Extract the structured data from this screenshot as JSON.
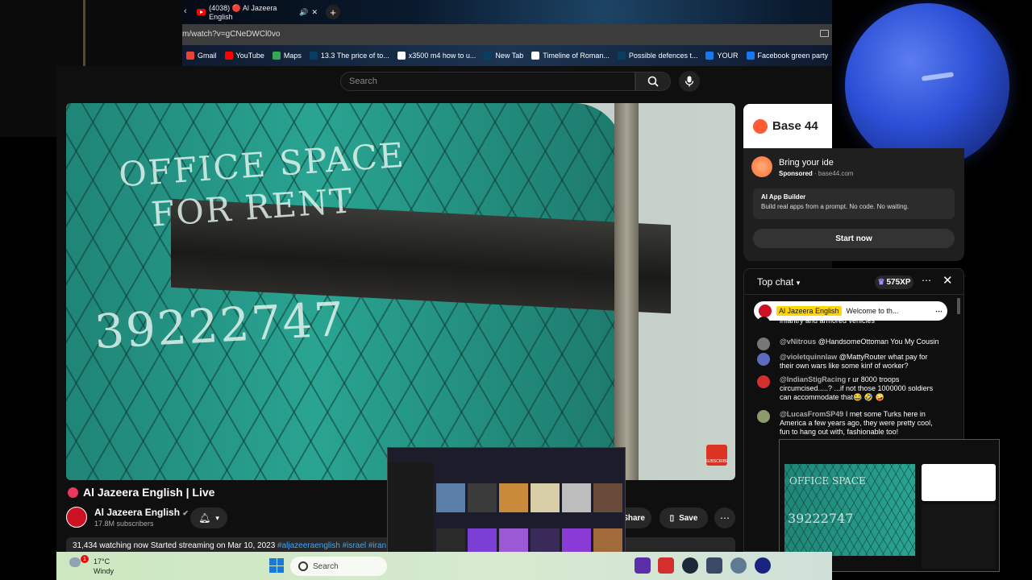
{
  "browser": {
    "tab_title": "(4038) 🔴 Al Jazeera English",
    "url": "m/watch?v=gCNeDWCl0vo",
    "bookmarks": [
      {
        "label": "Gmail",
        "color": "#ea4335"
      },
      {
        "label": "YouTube",
        "color": "#ff0000"
      },
      {
        "label": "Maps",
        "color": "#34a853"
      },
      {
        "label": "13.3 The price of to...",
        "color": "#0a3d62"
      },
      {
        "label": "x3500 m4 how to u...",
        "color": "#ffffff"
      },
      {
        "label": "New Tab",
        "color": "#0a3d62"
      },
      {
        "label": "Timeline of Roman...",
        "color": "#ffffff"
      },
      {
        "label": "Possible defences t...",
        "color": "#0a3d62"
      },
      {
        "label": "YOUR",
        "color": "#1877f2"
      },
      {
        "label": "Facebook green party",
        "color": "#1877f2"
      }
    ]
  },
  "youtube": {
    "search_placeholder": "Search",
    "video": {
      "overlay_line1": "OFFICE SPACE",
      "overlay_line2": "FOR RENT",
      "overlay_number": "39222747",
      "subscribe_badge": "SUBSCRIBE"
    },
    "title": "Al Jazeera English | Live",
    "channel_name": "Al Jazeera English",
    "subscribers": "17.8M subscribers",
    "share_label": "Share",
    "save_label": "Save",
    "description_line": "31,434 watching now  Started streaming on Mar 10, 2023",
    "description_tags": "#aljazeeraenglish #israel #iran"
  },
  "ad": {
    "brand": "Base 44",
    "headline": "Bring your ide",
    "sponsored": "Sponsored",
    "domain": "base44.com",
    "card_title": "AI App Builder",
    "card_text": "Build real apps from a prompt. No code. No waiting.",
    "cta": "Start now"
  },
  "chat": {
    "header": "Top chat",
    "xp": "575XP",
    "pinned_name": "Al Jazeera English",
    "pinned_text": "Welcome to th...",
    "messages": [
      {
        "user": "",
        "text": "infantry and armored vehicles",
        "color": "#0f0f0f"
      },
      {
        "user": "@vNitrous",
        "text": "@HandsomeOttoman You My Cousin",
        "color": "#777777"
      },
      {
        "user": "@violetquinnlaw",
        "text": "@MattyRouter what pay for their own wars like some kinf of worker?",
        "color": "#5c6bc0"
      },
      {
        "user": "@IndianStigRacing",
        "text": "r ur 8000 troops circumcised.....? ...if not those 1000000 soldiers can accommodate that😂 🤣 🤪",
        "color": "#d32f2f"
      },
      {
        "user": "@LucasFromSP49",
        "text": "I met some Turks here in America a few years ago, they were pretty cool, fun to hang out with, fashionable too!",
        "color": "#8d9a6a"
      }
    ]
  },
  "taskbar": {
    "temperature": "17°C",
    "condition": "Windy",
    "notification_count": "1",
    "search_label": "Search"
  }
}
